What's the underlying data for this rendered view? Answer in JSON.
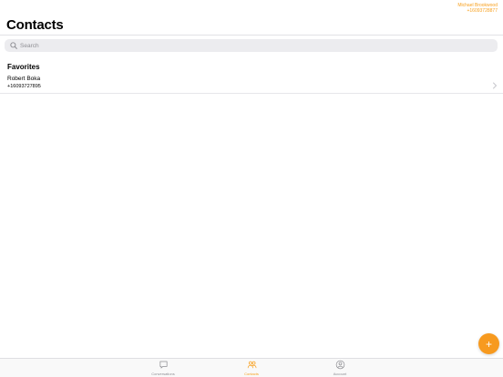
{
  "account": {
    "name": "Michael Brookwood",
    "phone": "+16093728877"
  },
  "page": {
    "title": "Contacts"
  },
  "search": {
    "placeholder": "Search"
  },
  "favorites": {
    "header": "Favorites",
    "contacts": [
      {
        "name": "Robert Boka",
        "phone": "+16093727895"
      }
    ]
  },
  "fab": {
    "label": "+"
  },
  "tabs": [
    {
      "label": "Conversations",
      "icon": "chat-bubble-icon",
      "active": false
    },
    {
      "label": "Contacts",
      "icon": "contacts-icon",
      "active": true
    },
    {
      "label": "Account",
      "icon": "account-icon",
      "active": false
    }
  ],
  "colors": {
    "accent": "#f7a01e",
    "fab": "#f79a1f",
    "search_bg": "#ececef",
    "inactive": "#8e8e93"
  }
}
